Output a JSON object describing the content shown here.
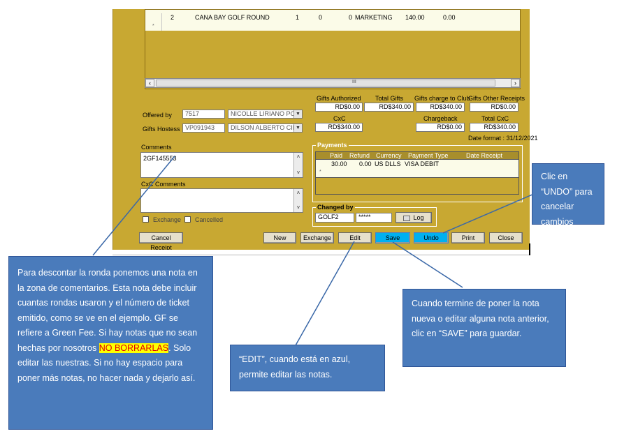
{
  "grid": {
    "row_partial": [
      "2",
      "CANA BAY GOLF ROUND",
      "1",
      "0",
      "0",
      "MARKETING",
      "140.00",
      "0.00"
    ]
  },
  "totals": {
    "gifts_authorized_label": "Gifts Authorized",
    "gifts_authorized_value": "RD$0.00",
    "total_gifts_label": "Total Gifts",
    "total_gifts_value": "RD$340.00",
    "gifts_charge_label": "Gifts charge to Club",
    "gifts_charge_value": "RD$340.00",
    "gifts_other_label": "Gifts Other Receipts",
    "gifts_other_value": "RD$0.00",
    "cxc_label": "CxC",
    "cxc_value": "RD$340.00",
    "chargeback_label": "Chargeback",
    "chargeback_value": "RD$0.00",
    "total_cxc_label": "Total CxC",
    "total_cxc_value": "RD$340.00",
    "date_format": "Date format : 31/12/2021"
  },
  "offered": {
    "label": "Offered by",
    "code": "7517",
    "name": "NICOLLE LIRIANO PO"
  },
  "hostess": {
    "label": "Gifts Hostess",
    "code": "VP091943",
    "name": "DILSON ALBERTO CID"
  },
  "comments": {
    "label": "Comments",
    "value": "2GF145553"
  },
  "cxc_comments": {
    "label": "CxC Comments",
    "value": ""
  },
  "checks": {
    "exchange": "Exchange",
    "cancelled": "Cancelled"
  },
  "payments": {
    "title": "Payments",
    "headers": [
      "Paid",
      "Refund",
      "Currency",
      "Payment Type",
      "Date Receipt"
    ],
    "row": [
      "30.00",
      "0.00",
      "US DLLS",
      "VISA DEBIT",
      ""
    ]
  },
  "changed_by": {
    "title": "Changed by",
    "user": "GOLF2",
    "password": "*****",
    "log_label": "Log"
  },
  "buttons": {
    "cancel_receipt": "Cancel Receipt",
    "new": "New",
    "exchange": "Exchange",
    "edit": "Edit",
    "save": "Save",
    "undo": "Undo",
    "print": "Print",
    "close": "Close"
  },
  "callouts": {
    "undo": "Clic en “UNDO” para cancelar cambios",
    "save": "Cuando termine de poner la nota nueva o editar alguna nota anterior, clic en “SAVE” para guardar.",
    "edit": "“EDIT”, cuando está en azul, permite editar las notas.",
    "comments_part1": "Para descontar la ronda ponemos una nota en la zona de comentarios. Esta nota debe incluir cuantas rondas usaron y el número de ticket emitido, como se ve en el ejemplo. GF se refiere a Green Fee. Si hay notas que no sean hechas por nosotros ",
    "comments_highlight": "NO BORRARLAS",
    "comments_part2": ". Solo editar las nuestras. Si no hay espacio para poner más notas, no hacer nada y dejarlo así."
  },
  "colors": {
    "app_background": "#c8a832",
    "callout_fill": "#4a7bbb",
    "button_active": "#00b0f0",
    "highlight": "#ffff00",
    "highlight_text": "#e00000"
  }
}
